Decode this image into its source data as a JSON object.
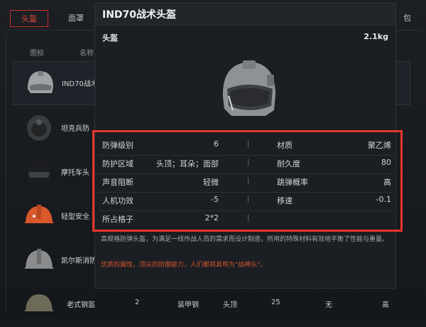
{
  "tabs": {
    "active": "头盔",
    "second": "面罩",
    "partial": "包"
  },
  "list": {
    "header_icon": "图标",
    "header_name": "名称",
    "rows": [
      {
        "name": "IND70战术"
      },
      {
        "name": "坦克兵防"
      },
      {
        "name": "摩托车头"
      },
      {
        "name": "轻型安全"
      },
      {
        "name": "凯尔斯消防"
      }
    ],
    "last_row": {
      "name": "老式钢盔",
      "c1": "2",
      "c2": "装甲钢",
      "c3": "头顶",
      "c4": "25",
      "c5": "无",
      "c6": "高"
    }
  },
  "popup": {
    "title": "IND70战术头盔",
    "category": "头盔",
    "weight": "2.1kg",
    "stats": [
      {
        "l1": "防弹级别",
        "v1": "6",
        "l2": "材质",
        "v2": "聚乙烯"
      },
      {
        "l1": "防护区域",
        "v1": "头顶；耳朵；面部",
        "l2": "耐久度",
        "v2": "80"
      },
      {
        "l1": "声音阻断",
        "v1": "轻微",
        "l2": "跳弹概率",
        "v2": "高"
      },
      {
        "l1": "人机功效",
        "v1": "-5",
        "l2": "移速",
        "v2": "-0.1"
      },
      {
        "l1": "所占格子",
        "v1": "2*2",
        "l2": "",
        "v2": ""
      }
    ],
    "separator": "|",
    "description": "高规格防弹头盔，为满足一线作战人员的需求而设计制造，所用的特殊材料有效地平衡了性能与重量。",
    "highlight": "优质的属性，顶尖的防御能力，人们都将其称为\"战神头\"。"
  },
  "colors": {
    "accent_red": "#e7352b",
    "highlight_text": "#d5552f"
  }
}
